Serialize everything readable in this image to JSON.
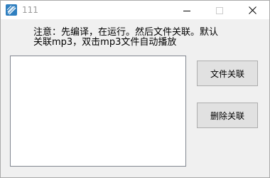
{
  "window": {
    "title": "111"
  },
  "notice": {
    "line1": "注意：先编译，在运行。然后文件关联。默认",
    "line2": "关联mp3，双击mp3文件自动播放"
  },
  "buttons": {
    "associate_label": "文件关联",
    "remove_label": "删除关联"
  },
  "icons": {
    "app": "app-icon",
    "minimize": "minimize-icon",
    "maximize": "maximize-icon",
    "close": "close-icon"
  },
  "colors": {
    "title_text": "#9a9a9a",
    "button_face": "#e1e1e1",
    "window_bg": "#f0f0f0",
    "app_icon": "#3a8fcf"
  }
}
